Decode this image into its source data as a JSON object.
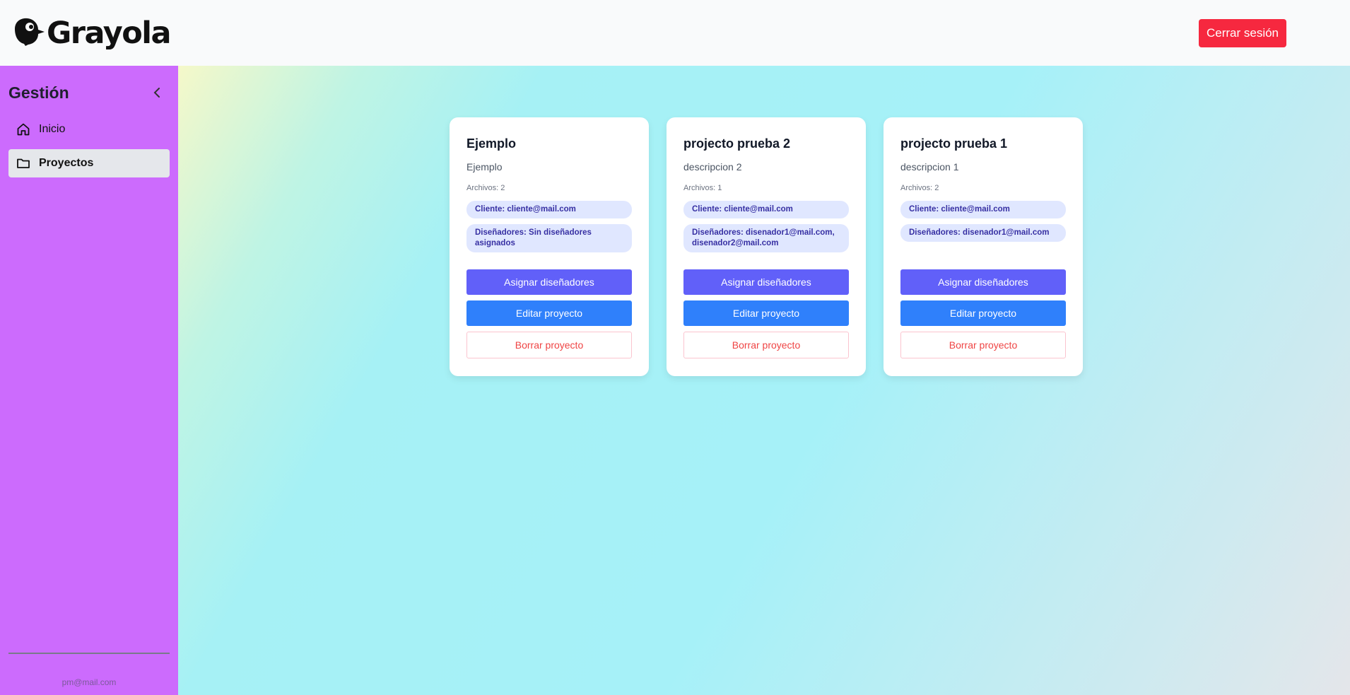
{
  "header": {
    "logo_text": "Grayola",
    "logout_label": "Cerrar sesión"
  },
  "sidebar": {
    "title": "Gestión",
    "items": [
      {
        "label": "Inicio",
        "icon": "home-icon",
        "active": false
      },
      {
        "label": "Proyectos",
        "icon": "folder-icon",
        "active": true
      }
    ],
    "user_email": "pm@mail.com"
  },
  "projects": [
    {
      "title": "Ejemplo",
      "description": "Ejemplo",
      "files": "Archivos: 2",
      "client": "Cliente: cliente@mail.com",
      "designers": "Diseñadores: Sin diseñadores asignados",
      "assign_label": "Asignar diseñadores",
      "edit_label": "Editar proyecto",
      "delete_label": "Borrar proyecto"
    },
    {
      "title": "projecto prueba 2",
      "description": "descripcion 2",
      "files": "Archivos: 1",
      "client": "Cliente: cliente@mail.com",
      "designers": "Diseñadores: disenador1@mail.com, disenador2@mail.com",
      "assign_label": "Asignar diseñadores",
      "edit_label": "Editar proyecto",
      "delete_label": "Borrar proyecto"
    },
    {
      "title": "projecto prueba 1",
      "description": "descripcion 1",
      "files": "Archivos: 2",
      "client": "Cliente: cliente@mail.com",
      "designers": "Diseñadores: disenador1@mail.com",
      "assign_label": "Asignar diseñadores",
      "edit_label": "Editar proyecto",
      "delete_label": "Borrar proyecto"
    }
  ],
  "colors": {
    "sidebar_bg": "#cc6bfd",
    "logout_bg": "#f6283f",
    "assign_bg": "#6160f9",
    "edit_bg": "#2f80fb",
    "delete_text": "#ef4444"
  }
}
